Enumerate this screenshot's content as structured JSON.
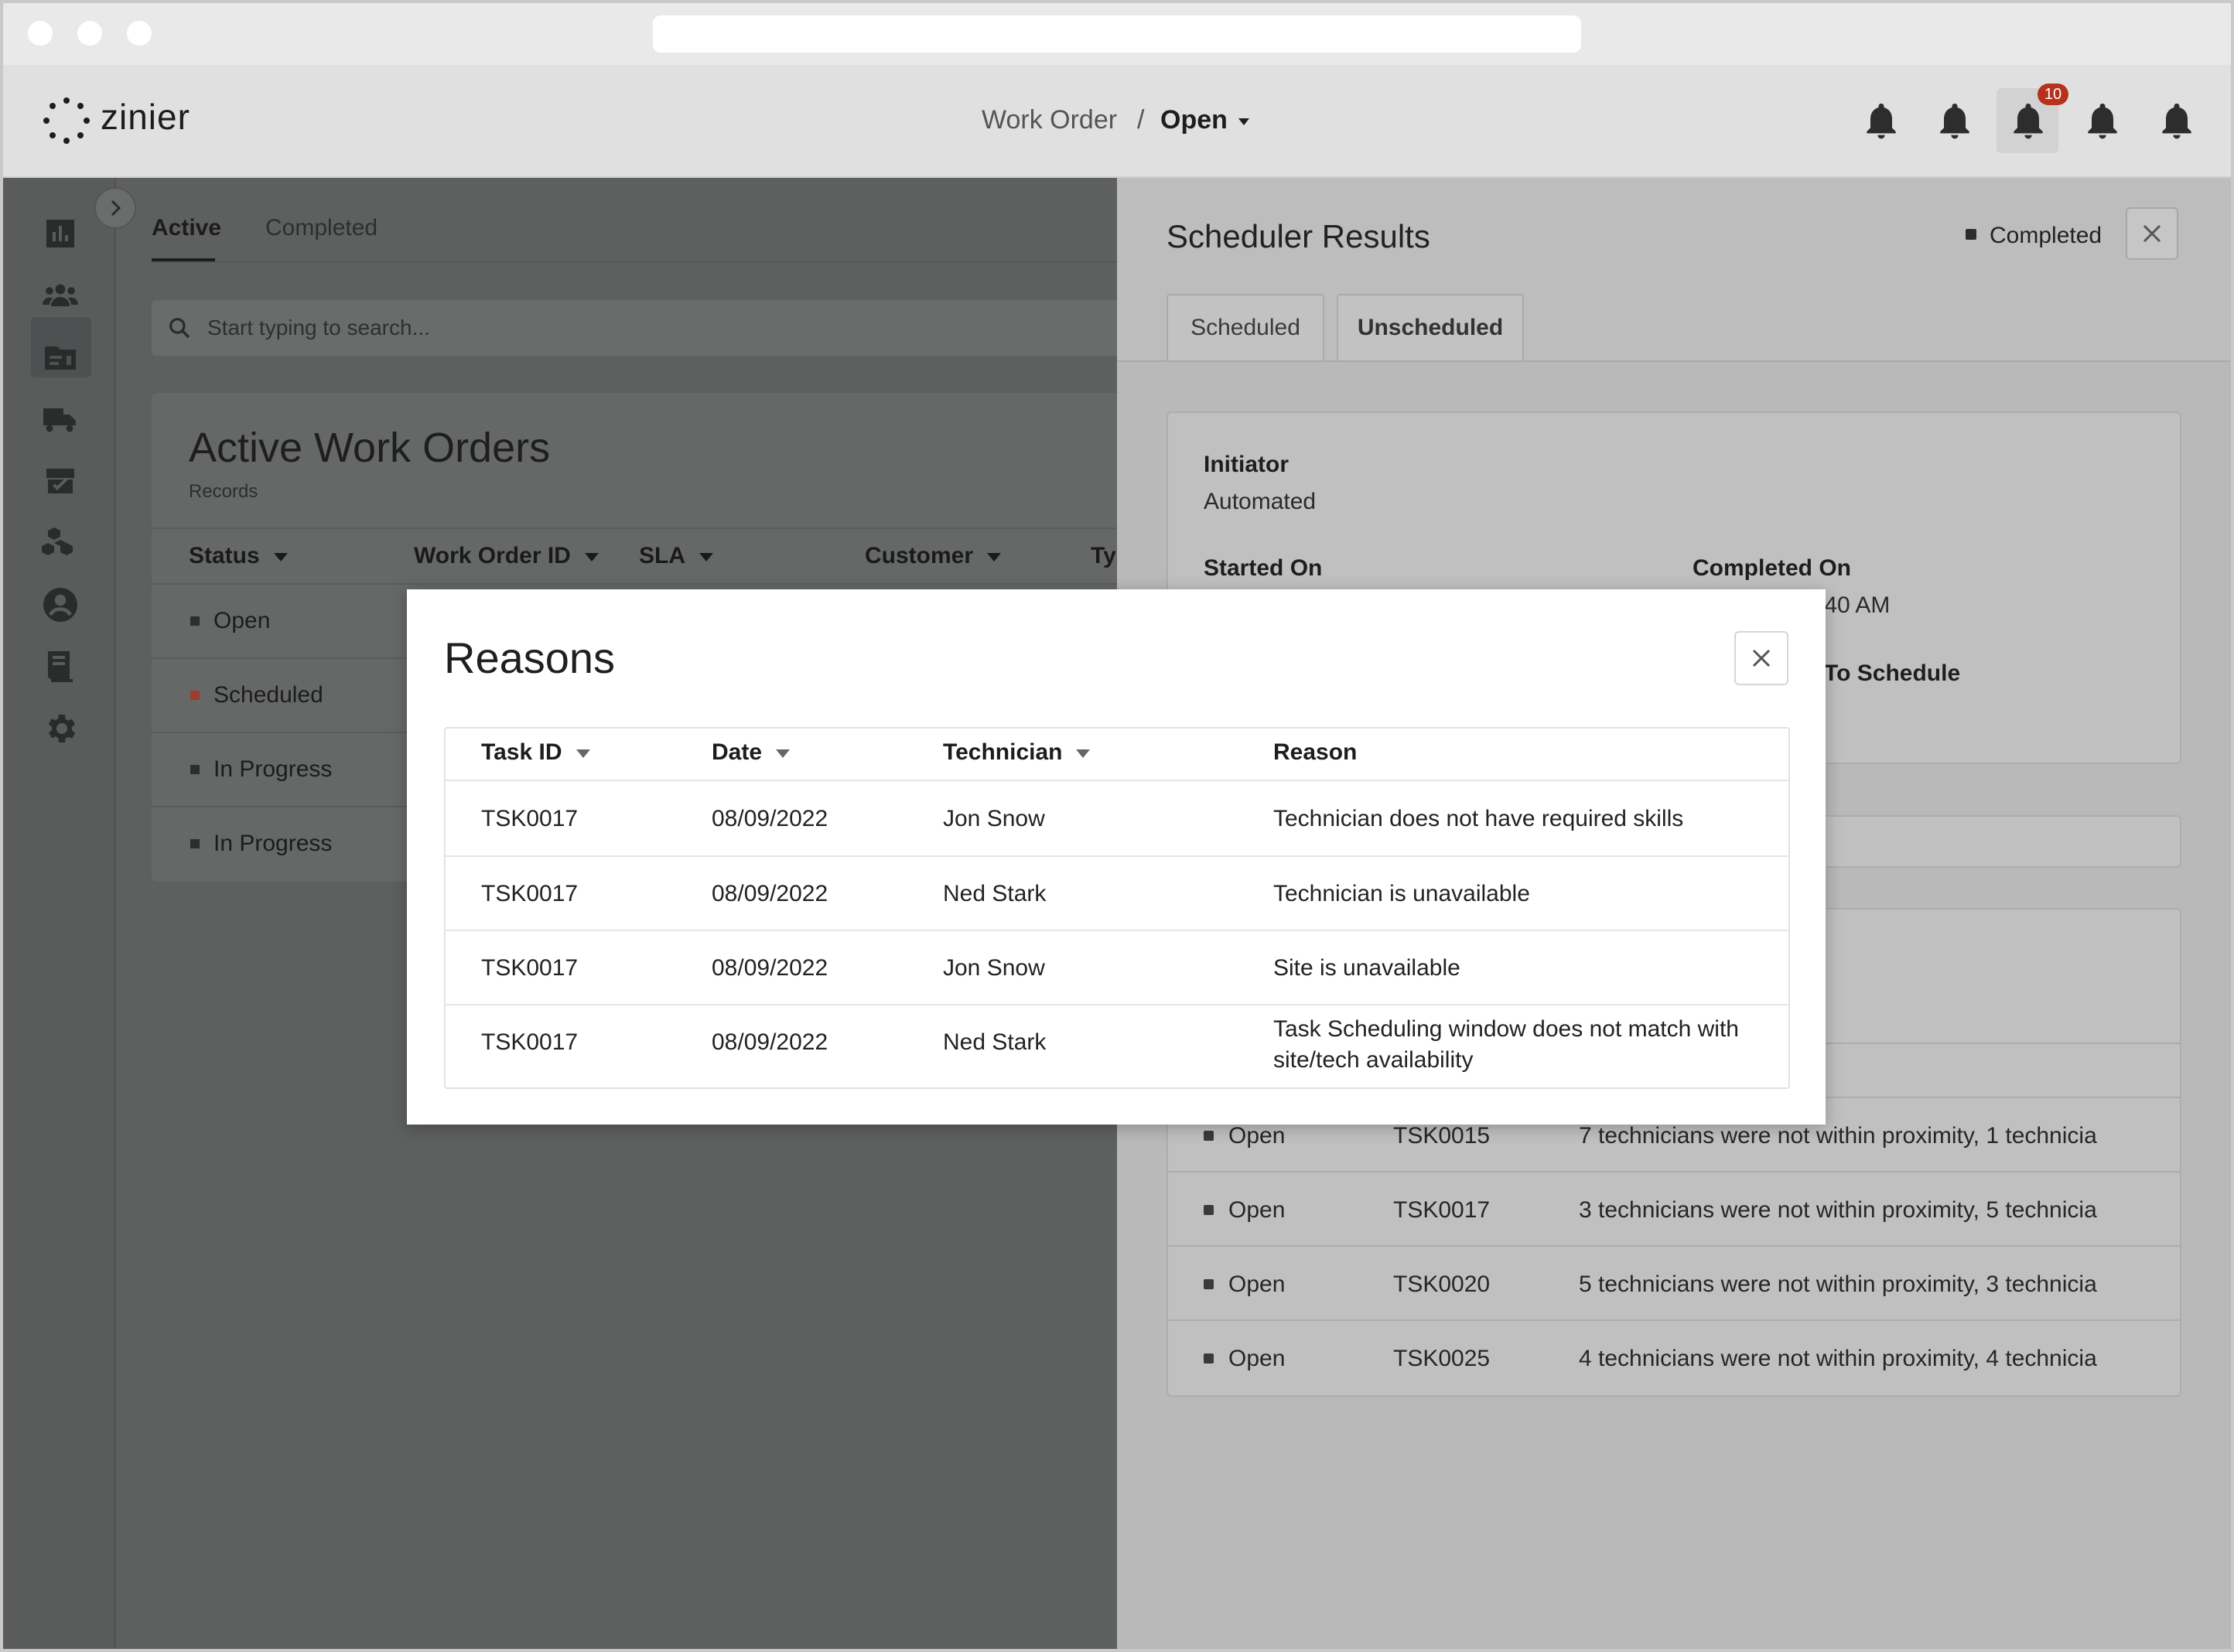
{
  "app": {
    "logo_text": "zinier",
    "breadcrumb": {
      "parent": "Work Order",
      "separator": "/",
      "current": "Open"
    },
    "notification_badge": "10"
  },
  "left": {
    "tabs": [
      {
        "label": "Active",
        "active": true
      },
      {
        "label": "Completed",
        "active": false
      }
    ],
    "search_placeholder": "Start typing to search...",
    "card": {
      "title": "Active Work Orders",
      "subtitle": "Records",
      "columns": [
        "Status",
        "Work Order ID",
        "SLA",
        "Customer",
        "Ty"
      ],
      "rows": [
        {
          "status": "Open",
          "color": "#2d2f2f"
        },
        {
          "status": "Scheduled",
          "color": "#9b3f2c"
        },
        {
          "status": "In Progress",
          "color": "#2d2f2f"
        },
        {
          "status": "In Progress",
          "color": "#2d2f2f"
        }
      ]
    }
  },
  "panel": {
    "title": "Scheduler Results",
    "status": "Completed",
    "tabs": [
      "Scheduled",
      "Unscheduled"
    ],
    "initiator_label": "Initiator",
    "initiator_value": "Automated",
    "started_on_label": "Started On",
    "completed_on_label": "Completed On",
    "completed_on_value_visible": ":40 AM",
    "to_schedule_label_visible": "To Schedule",
    "rows": [
      {
        "status": "Open",
        "task": "TSK0015",
        "reason": "7 technicians were not within proximity, 1 technicia"
      },
      {
        "status": "Open",
        "task": "TSK0017",
        "reason": "3 technicians were not within proximity, 5 technicia"
      },
      {
        "status": "Open",
        "task": "TSK0020",
        "reason": "5 technicians were not within proximity, 3 technicia"
      },
      {
        "status": "Open",
        "task": "TSK0025",
        "reason": "4 technicians were not within proximity, 4 technicia"
      }
    ]
  },
  "modal": {
    "title": "Reasons",
    "columns": [
      "Task ID",
      "Date",
      "Technician",
      "Reason"
    ],
    "rows": [
      {
        "task": "TSK0017",
        "date": "08/09/2022",
        "tech": "Jon Snow",
        "reason": "Technician does not have required skills",
        "reason2": ""
      },
      {
        "task": "TSK0017",
        "date": "08/09/2022",
        "tech": "Ned Stark",
        "reason": "Technician is unavailable",
        "reason2": ""
      },
      {
        "task": "TSK0017",
        "date": "08/09/2022",
        "tech": "Jon Snow",
        "reason": "Site is unavailable",
        "reason2": ""
      },
      {
        "task": "TSK0017",
        "date": "08/09/2022",
        "tech": "Ned Stark",
        "reason": "Task Scheduling window does not match with",
        "reason2": "site/tech availability"
      }
    ]
  },
  "colors": {
    "accent_red": "#b6321c",
    "overlay_dark": "#5e6060"
  }
}
